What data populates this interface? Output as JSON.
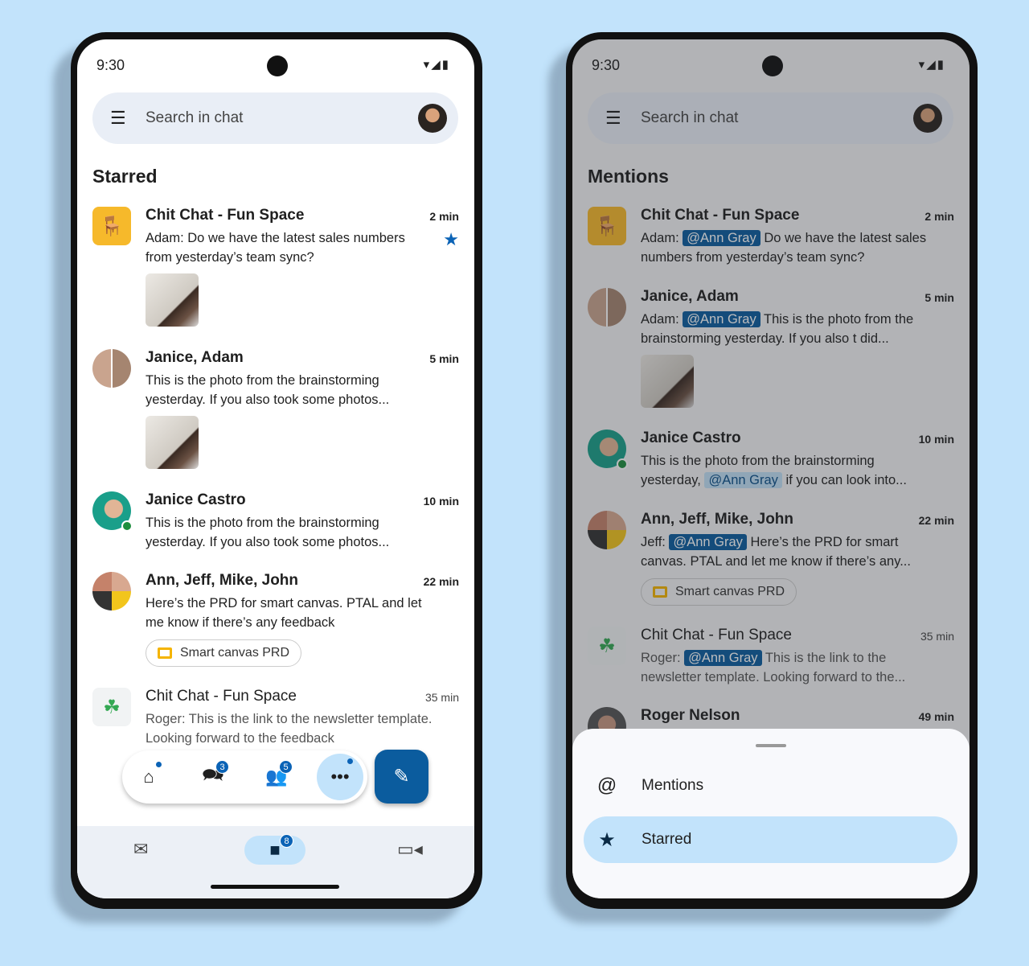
{
  "left": {
    "status_time": "9:30",
    "search_placeholder": "Search in chat",
    "heading": "Starred",
    "items": [
      {
        "title": "Chit Chat - Fun Space",
        "time": "2 min",
        "message": "Adam: Do we have the latest sales numbers from yesterday’s team sync?",
        "starred": true
      },
      {
        "title": "Janice, Adam",
        "time": "5 min",
        "message": "This is the photo from the brainstorming yesterday. If you also took some photos..."
      },
      {
        "title": "Janice Castro",
        "time": "10 min",
        "message": "This is the photo from the brainstorming yesterday. If you also took some photos..."
      },
      {
        "title": "Ann, Jeff, Mike, John",
        "time": "22 min",
        "message": "Here’s the PRD for smart canvas. PTAL and let me know if there’s any feedback",
        "attachment": "Smart canvas PRD"
      },
      {
        "title": "Chit Chat - Fun Space",
        "time": "35 min",
        "message": "Roger: This is the link to the newsletter template. Looking forward to the feedback"
      }
    ],
    "nav_badges": {
      "chats": "3",
      "spaces": "5",
      "chat_tab": "8"
    }
  },
  "right": {
    "status_time": "9:30",
    "search_placeholder": "Search in chat",
    "heading": "Mentions",
    "items": [
      {
        "title": "Chit Chat - Fun Space",
        "time": "2 min",
        "prefix": "Adam: ",
        "mention": "@Ann Gray",
        "text": " Do we have the latest sales numbers from yesterday’s team sync?"
      },
      {
        "title": "Janice, Adam",
        "time": "5 min",
        "prefix": "Adam: ",
        "mention": "@Ann Gray",
        "text": " This is the photo from the brainstorming yesterday. If you also t  did..."
      },
      {
        "title": "Janice Castro",
        "time": "10 min",
        "prefix": "This is the photo from the brainstorming yesterday, ",
        "mention": "@Ann Gray",
        "text": " if you can look into..."
      },
      {
        "title": "Ann, Jeff, Mike, John",
        "time": "22 min",
        "prefix": "Jeff: ",
        "mention": "@Ann Gray",
        "text": " Here’s the PRD for smart canvas. PTAL and let me know if there’s any...",
        "attachment": "Smart canvas PRD"
      },
      {
        "title": "Chit Chat - Fun Space",
        "time": "35 min",
        "prefix": "Roger: ",
        "mention": "@Ann Gray",
        "text": " This is the link to the newsletter template. Looking forward to the..."
      },
      {
        "title": "Roger Nelson",
        "time": "49 min"
      }
    ],
    "sheet": {
      "options": [
        {
          "label": "Mentions",
          "icon": "at-icon"
        },
        {
          "label": "Starred",
          "icon": "star-icon",
          "selected": true
        }
      ]
    }
  },
  "colors": {
    "background": "#c2e3fb",
    "accent": "#0b5c9e",
    "selected": "#c2e3fb"
  }
}
